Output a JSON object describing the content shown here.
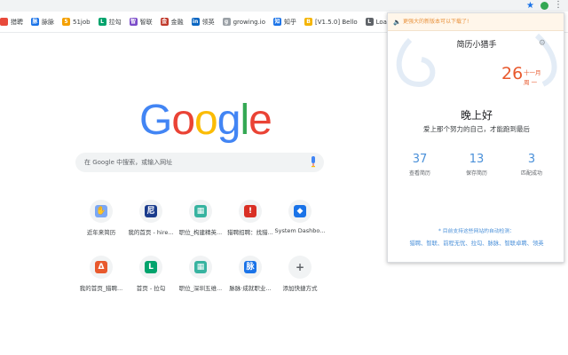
{
  "browser": {
    "star_icon": "star-icon",
    "bookmarks": [
      {
        "label": "猎聘",
        "color": "#e84a3b",
        "glyph": ""
      },
      {
        "label": "脉脉",
        "color": "#1a73e8",
        "glyph": "脉"
      },
      {
        "label": "51job",
        "color": "#f4a000",
        "glyph": "5"
      },
      {
        "label": "拉勾",
        "color": "#00a36c",
        "glyph": "L"
      },
      {
        "label": "智联",
        "color": "#7b4cc9",
        "glyph": "智"
      },
      {
        "label": "金融",
        "color": "#c0392b",
        "glyph": "金"
      },
      {
        "label": "领英",
        "color": "#0a66c2",
        "glyph": "in"
      },
      {
        "label": "growing.io",
        "color": "#9aa0a6",
        "glyph": "g"
      },
      {
        "label": "知乎",
        "color": "#1a73e8",
        "glyph": "知"
      },
      {
        "label": "[V1.5.0] Bello",
        "color": "#f4b400",
        "glyph": "B"
      },
      {
        "label": "LoadRunner - 随略",
        "color": "#5f6368",
        "glyph": "L"
      }
    ]
  },
  "newtab": {
    "logo": [
      "G",
      "o",
      "o",
      "g",
      "l",
      "e"
    ],
    "logo_colors": [
      "#4285f4",
      "#ea4335",
      "#fbbc05",
      "#4285f4",
      "#34a853",
      "#ea4335"
    ],
    "search_placeholder": "在 Google 中搜索，或输入网址",
    "tiles": [
      {
        "label": "近年来简历",
        "icon": "hand-icon",
        "color": "#7aa7f5",
        "glyph": "✋"
      },
      {
        "label": "我的首页 - hire...",
        "icon": "hire-icon",
        "color": "#1a3b8c",
        "glyph": "尼"
      },
      {
        "label": "职位_构建精英...",
        "icon": "grid-icon",
        "color": "#37b3a0",
        "glyph": "▦"
      },
      {
        "label": "猎聘招聘：找猎...",
        "icon": "liepin-icon",
        "color": "#d93025",
        "glyph": "!"
      },
      {
        "label": "System Dashbo...",
        "icon": "diamond-icon",
        "color": "#1a73e8",
        "glyph": "◆"
      },
      {
        "label": "我的首页_猎聘...",
        "icon": "liepin-logo-icon",
        "color": "#e8592d",
        "glyph": "Δ"
      },
      {
        "label": "首页 - 拉勾",
        "icon": "lagou-icon",
        "color": "#00a36c",
        "glyph": "L"
      },
      {
        "label": "职位_深圳五维...",
        "icon": "grid-icon",
        "color": "#37b3a0",
        "glyph": "▦"
      },
      {
        "label": "脉脉·成就职业...",
        "icon": "maimai-icon",
        "color": "#1a73e8",
        "glyph": "脉"
      },
      {
        "label": "添加快捷方式",
        "icon": "plus-icon",
        "color": "#5f6368",
        "glyph": "+"
      }
    ]
  },
  "popup": {
    "notice": "更强大的新版本可以下载了!",
    "title": "简历小猎手",
    "day": "26",
    "month": "十一月",
    "weekday": "周 一",
    "greeting": "晚上好",
    "motto": "爱上那个努力的自己，才能跑到最后",
    "stats": [
      {
        "num": "37",
        "caption": "查看简历"
      },
      {
        "num": "13",
        "caption": "保存简历"
      },
      {
        "num": "3",
        "caption": "匹配成功"
      }
    ],
    "support": "* 目前支持这些网站的自动检测：",
    "sites": "猎聘、智联、前程无忧、拉勾、脉脉、智联卓聘、领英"
  }
}
